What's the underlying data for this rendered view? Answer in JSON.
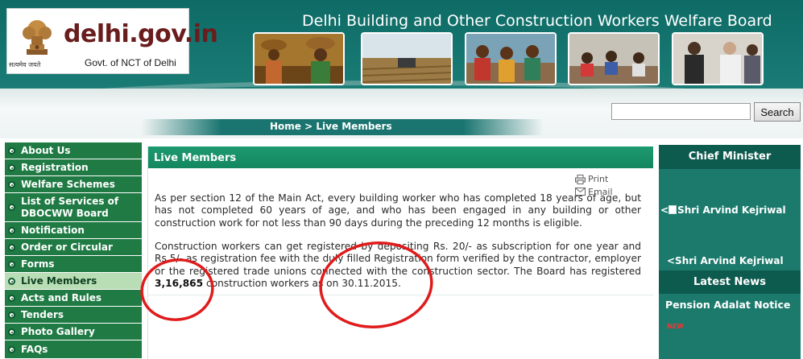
{
  "header": {
    "logo_text": "delhi.gov.in",
    "logo_subtitle": "Govt. of NCT of Delhi",
    "logo_motto": "सत्यमेव जयते",
    "site_title": "Delhi Building and Other Construction Workers Welfare Board",
    "search": {
      "value": "",
      "button_label": "Search"
    },
    "breadcrumb": "Home > Live Members"
  },
  "sidebar": {
    "items": [
      {
        "label": "About Us"
      },
      {
        "label": "Registration"
      },
      {
        "label": "Welfare Schemes"
      },
      {
        "label": "List of Services of DBOCWW Board"
      },
      {
        "label": "Notification"
      },
      {
        "label": "Order or Circular"
      },
      {
        "label": "Forms"
      },
      {
        "label": "Live Members",
        "active": true
      },
      {
        "label": "Acts and Rules"
      },
      {
        "label": "Tenders"
      },
      {
        "label": "Photo Gallery"
      },
      {
        "label": "FAQs"
      }
    ]
  },
  "main": {
    "title": "Live Members",
    "tools": {
      "print": "Print",
      "email": "Email"
    },
    "paragraph1": "As per section 12 of the Main Act, every building worker who has completed 18 years of age, but has not completed 60 years of age, and who has been engaged in any building or other construction work for not less than 90 days during the preceding 12 months is eligible.",
    "paragraph2_before": "Construction workers can get registered by depositing Rs. 20/- as subscription for one year and Rs.5/- as registration fee with the duly filled Registration form verified by the contractor, employer or the registered trade unions connected with the construction sector. The Board has registered ",
    "registered_count": "3,16,865",
    "paragraph2_after": " construction workers as on 30.11.2015."
  },
  "right_panel": {
    "cm_header": "Chief Minister",
    "cm_photo_alt": "Shri Arvind Kejriwal",
    "cm_link": "<Shri Arvind Kejriwal",
    "news_header": "Latest News",
    "news_item": "Pension Adalat Notice",
    "news_badge": "NEW"
  },
  "colors": {
    "header_teal": "#0e6b66",
    "nav_green": "#1f7a44",
    "nav_active": "#b9ddb4",
    "title_bar": "#138660",
    "right_panel": "#1b7a6c",
    "annotation_red": "#e01b1b"
  },
  "icons": [
    "emblem-icon",
    "print-icon",
    "email-icon",
    "nav-bullet-icon",
    "broken-image-icon"
  ]
}
